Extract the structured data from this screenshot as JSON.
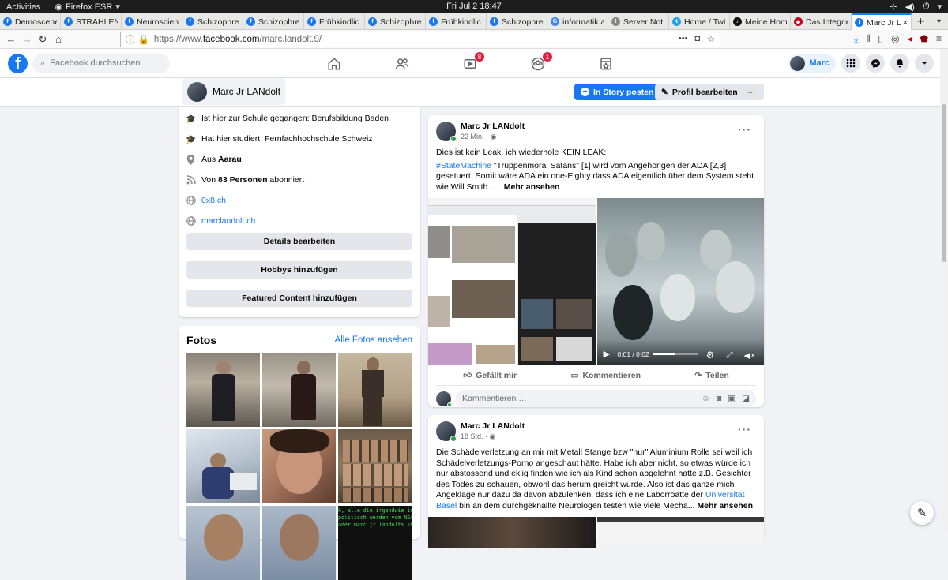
{
  "system": {
    "activities": "Activities",
    "app": "Firefox ESR",
    "clock": "Fri Jul 2  18:47"
  },
  "tabs": [
    {
      "label": "Demoscene",
      "color": "#1877f2",
      "glyph": "f"
    },
    {
      "label": "STRAHLEN",
      "color": "#1877f2",
      "glyph": "f"
    },
    {
      "label": "Neuroscien",
      "color": "#1877f2",
      "glyph": "f"
    },
    {
      "label": "Schizophre",
      "color": "#1877f2",
      "glyph": "f"
    },
    {
      "label": "Schizophre",
      "color": "#1877f2",
      "glyph": "f"
    },
    {
      "label": "Frühkindlic",
      "color": "#1877f2",
      "glyph": "f"
    },
    {
      "label": "Schizophre",
      "color": "#1877f2",
      "glyph": "f"
    },
    {
      "label": "Frühkindlic",
      "color": "#1877f2",
      "glyph": "f"
    },
    {
      "label": "Schizophre",
      "color": "#1877f2",
      "glyph": "f"
    },
    {
      "label": "informatik a",
      "color": "#4285f4",
      "glyph": "G"
    },
    {
      "label": "Server Not F",
      "color": "#888888",
      "glyph": "!"
    },
    {
      "label": "Home / Twit",
      "color": "#1da1f2",
      "glyph": "t"
    },
    {
      "label": "Meine Hom",
      "color": "#111111",
      "glyph": "♪"
    },
    {
      "label": "Das Integrie",
      "color": "#c4001a",
      "glyph": "◆"
    },
    {
      "label": "Marc Jr L",
      "color": "#1877f2",
      "glyph": "f",
      "active": true
    }
  ],
  "url": {
    "prefix": "https://www.",
    "host": "facebook.com",
    "path": "/marc.landolt.9/"
  },
  "fb": {
    "search_placeholder": "Facebook durchsuchen",
    "badges": {
      "watch": "8",
      "groups": "1"
    },
    "me_name": "Marc"
  },
  "profile": {
    "name": "Marc Jr LANdolt",
    "story_button": "In Story posten",
    "edit_button": "Profil bearbeiten",
    "more_button": "···"
  },
  "intro": {
    "school": "Ist hier zur Schule gegangen: Berufsbildung Baden",
    "studied": "Hat hier studiert: Fernfachhochschule Schweiz",
    "from_prefix": "Aus ",
    "from_city": "Aarau",
    "followers_prefix": "Von ",
    "followers_count": "83 Personen",
    "followers_suffix": " abonniert",
    "link1": "0x8.ch",
    "link2": "marclandolt.ch",
    "btn_details": "Details bearbeiten",
    "btn_hobbies": "Hobbys hinzufügen",
    "btn_featured": "Featured Content hinzufügen"
  },
  "photos": {
    "title": "Fotos",
    "all": "Alle Fotos ansehen",
    "overlay_lines": [
      "h, alle die irgendwie in z",
      "politisch werden vom NSA/C",
      "oder marc jr landolts sti"
    ]
  },
  "post1": {
    "author": "Marc Jr LANdolt",
    "time": "22 Min. · ",
    "line1": "Dies ist kein Leak, ich wiederhole KEIN LEAK:",
    "hashtag": "#StateMachine",
    "text": " \"Truppenmoral Satans\" [1] wird vom Angehörigen der ADA [2,3] gesetuert. Somit wäre ADA ein one-Eighty dass ADA eigentlich über dem System steht wie Will Smith...... ",
    "more": "Mehr ansehen",
    "video_time": "0:01 / 0:02",
    "like": "Gefällt mir",
    "comment": "Kommentieren",
    "share": "Teilen",
    "comment_placeholder": "Kommentieren …"
  },
  "post2": {
    "author": "Marc Jr LANdolt",
    "time": "18 Std. · ",
    "text1": "Die Schädelverletzung an mir mit Metall Stange bzw \"nur\" Aluminium Rolle sei weil ich Schädelverletzungs-Porno angeschaut hätte. Habe ich aber nicht, so etwas würde ich nur abstossend und eklig finden wie ich als Kind schon abgelehnt hatte z.B. Gesichter des Todes zu schauen, obwohl das herum greicht wurde. Also ist das ganze mich Angeklage nur dazu da davon abzulenken, dass ich eine Laborroatte der ",
    "uni": "Universität Basel",
    "text2": " bin an dem durchgeknallte Neurologen testen wie viele Mecha... ",
    "more": "Mehr ansehen"
  },
  "colors": {
    "accent": "#1877f2",
    "badge": "#e41e3f"
  }
}
